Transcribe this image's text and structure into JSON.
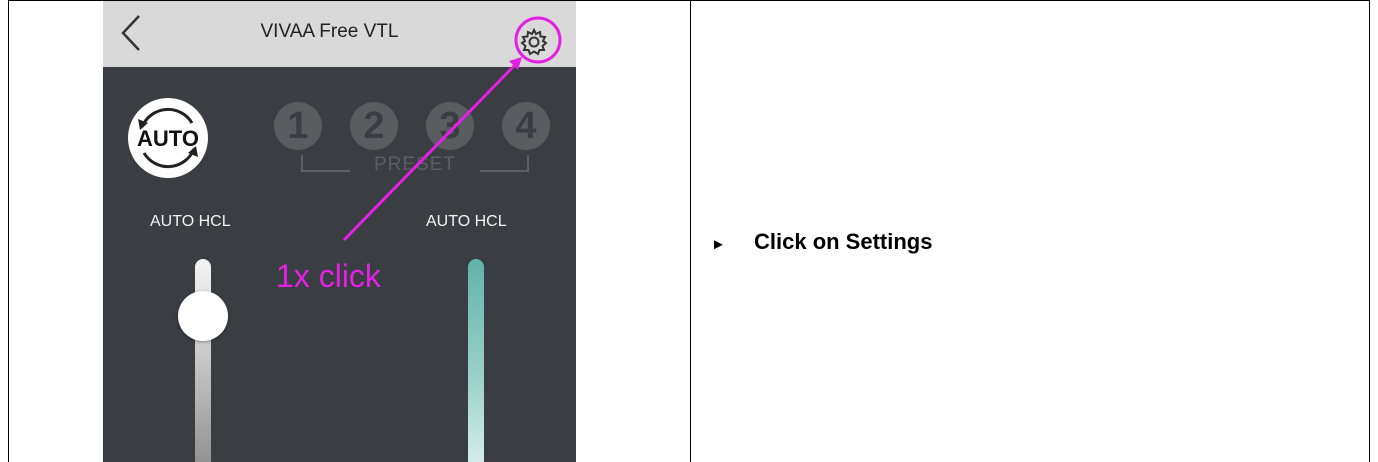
{
  "app": {
    "title": "VIVAA Free VTL",
    "back_icon": "chevron-left-icon",
    "settings_icon": "gear-icon"
  },
  "controls": {
    "auto_label": "AUTO",
    "presets": [
      "1",
      "2",
      "3",
      "4"
    ],
    "preset_label": "PRESET",
    "left_slider_label": "AUTO HCL",
    "right_slider_label": "AUTO HCL"
  },
  "annotation": {
    "callout": "1x click",
    "color": "#e520e5"
  },
  "instruction": {
    "bullet": "►",
    "text": "Click on Settings"
  }
}
